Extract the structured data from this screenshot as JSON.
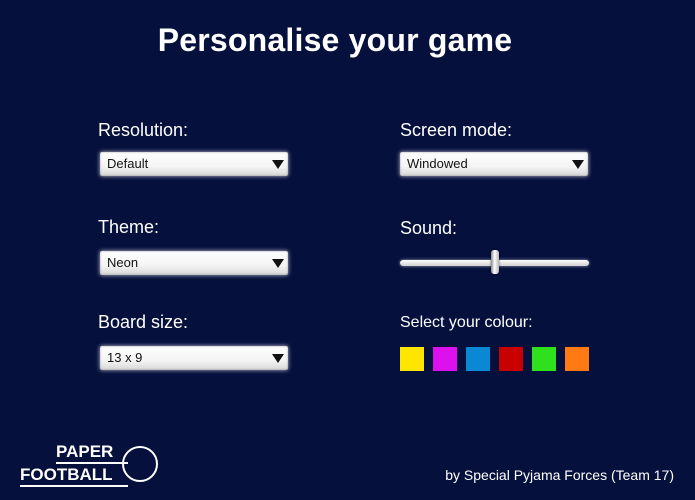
{
  "title": "Personalise your game",
  "settings": {
    "resolution": {
      "label": "Resolution:",
      "value": "Default"
    },
    "screen_mode": {
      "label": "Screen mode:",
      "value": "Windowed"
    },
    "theme": {
      "label": "Theme:",
      "value": "Neon"
    },
    "sound": {
      "label": "Sound:",
      "level": 0.5
    },
    "board_size": {
      "label": "Board size:",
      "value": "13 x 9"
    },
    "colour": {
      "label": "Select your colour:",
      "swatches": [
        "#ffe600",
        "#dd11ee",
        "#0a88d4",
        "#c90000",
        "#2fe11d",
        "#ff7a12"
      ]
    }
  },
  "logo": {
    "line1": "PAPER",
    "line2": "FOOTBALL"
  },
  "footer": {
    "credit": "by Special Pyjama Forces (Team 17)"
  },
  "icons": {
    "dropdown": "chevron-down-icon",
    "logo_ball": "football-icon"
  },
  "colors": {
    "background": "#06103d",
    "text": "#ffffff"
  }
}
